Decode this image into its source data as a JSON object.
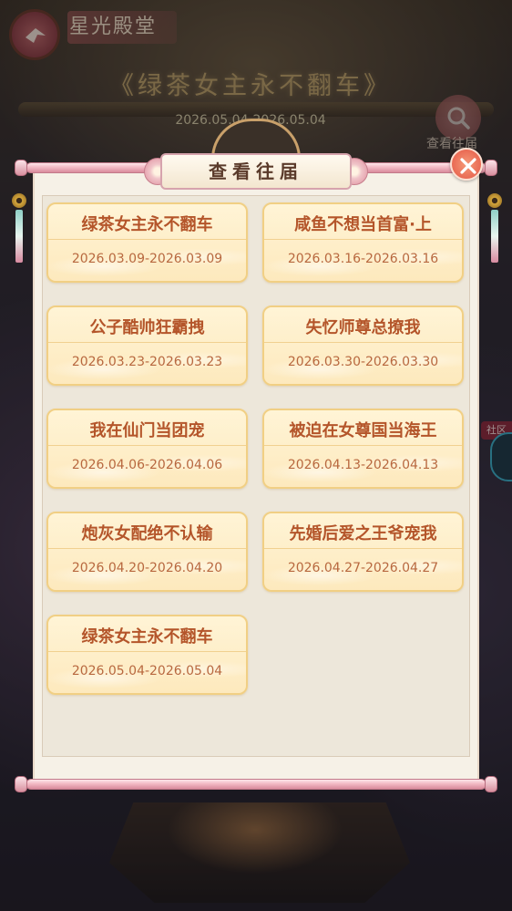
{
  "header": {
    "title": "星光殿堂",
    "banner_title": "《绿茶女主永不翻车》",
    "banner_date": "2026.05.04-2026.05.04",
    "search_label": "查看往届"
  },
  "side": {
    "community_label": "社区"
  },
  "modal": {
    "title": "查看往届",
    "editions": [
      {
        "name": "绿茶女主永不翻车",
        "date": "2026.03.09-2026.03.09"
      },
      {
        "name": "咸鱼不想当首富·上",
        "date": "2026.03.16-2026.03.16"
      },
      {
        "name": "公子酷帅狂霸拽",
        "date": "2026.03.23-2026.03.23"
      },
      {
        "name": "失忆师尊总撩我",
        "date": "2026.03.30-2026.03.30"
      },
      {
        "name": "我在仙门当团宠",
        "date": "2026.04.06-2026.04.06"
      },
      {
        "name": "被迫在女尊国当海王",
        "date": "2026.04.13-2026.04.13"
      },
      {
        "name": "炮灰女配绝不认输",
        "date": "2026.04.20-2026.04.20"
      },
      {
        "name": "先婚后爱之王爷宠我",
        "date": "2026.04.27-2026.04.27"
      },
      {
        "name": "绿茶女主永不翻车",
        "date": "2026.05.04-2026.05.04"
      }
    ]
  },
  "icons": {
    "back": "bird-arrow-icon",
    "search": "magnifier-icon",
    "close": "close-x-icon"
  }
}
